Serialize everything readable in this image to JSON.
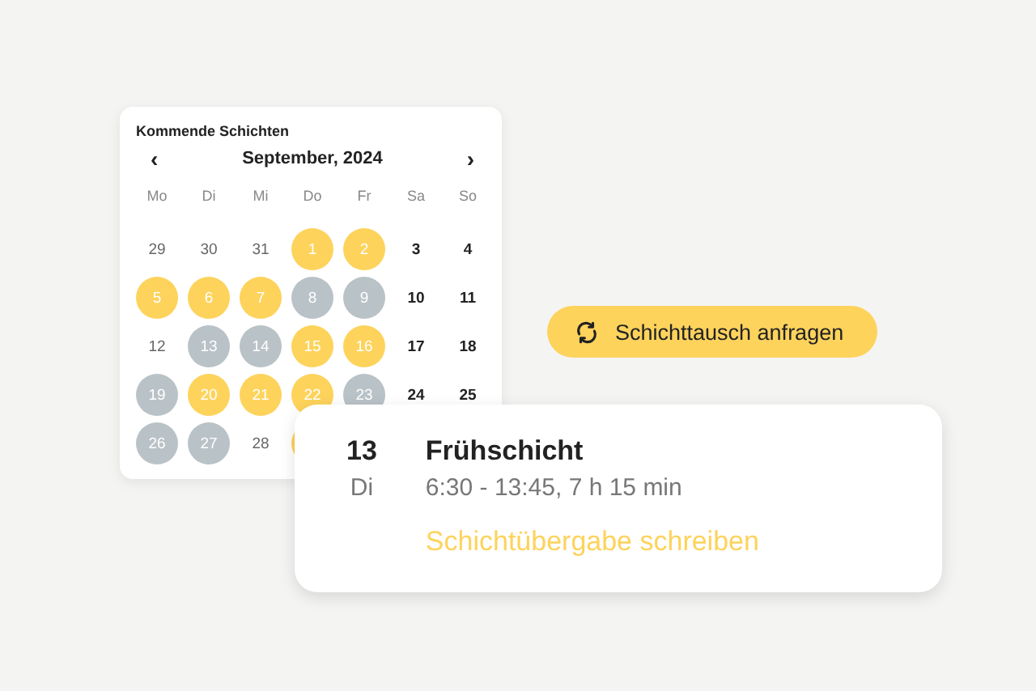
{
  "calendar": {
    "title": "Kommende Schichten",
    "prev": "‹",
    "month": "September, 2024",
    "next": "›",
    "weekdays": [
      "Mo",
      "Di",
      "Mi",
      "Do",
      "Fr",
      "Sa",
      "So"
    ],
    "days": [
      {
        "label": "29",
        "kind": "outside"
      },
      {
        "label": "30",
        "kind": "outside"
      },
      {
        "label": "31",
        "kind": "outside"
      },
      {
        "label": "1",
        "kind": "shift"
      },
      {
        "label": "2",
        "kind": "shift"
      },
      {
        "label": "3",
        "kind": "plain"
      },
      {
        "label": "4",
        "kind": "plain"
      },
      {
        "label": "5",
        "kind": "shift"
      },
      {
        "label": "6",
        "kind": "shift"
      },
      {
        "label": "7",
        "kind": "shift"
      },
      {
        "label": "8",
        "kind": "off"
      },
      {
        "label": "9",
        "kind": "off"
      },
      {
        "label": "10",
        "kind": "plain"
      },
      {
        "label": "11",
        "kind": "plain"
      },
      {
        "label": "12",
        "kind": "outside"
      },
      {
        "label": "13",
        "kind": "off"
      },
      {
        "label": "14",
        "kind": "off"
      },
      {
        "label": "15",
        "kind": "shift"
      },
      {
        "label": "16",
        "kind": "shift"
      },
      {
        "label": "17",
        "kind": "plain"
      },
      {
        "label": "18",
        "kind": "plain"
      },
      {
        "label": "19",
        "kind": "off"
      },
      {
        "label": "20",
        "kind": "shift"
      },
      {
        "label": "21",
        "kind": "shift"
      },
      {
        "label": "22",
        "kind": "shift"
      },
      {
        "label": "23",
        "kind": "off"
      },
      {
        "label": "24",
        "kind": "plain"
      },
      {
        "label": "25",
        "kind": "plain"
      },
      {
        "label": "26",
        "kind": "off"
      },
      {
        "label": "27",
        "kind": "off"
      },
      {
        "label": "28",
        "kind": "outside"
      }
    ]
  },
  "swap_button": {
    "label": "Schichttausch anfragen"
  },
  "shift_card": {
    "day": "13",
    "weekday": "Di",
    "title": "Frühschicht",
    "time": "6:30 - 13:45, 7 h 15 min",
    "link": "Schichtübergabe schreiben"
  }
}
